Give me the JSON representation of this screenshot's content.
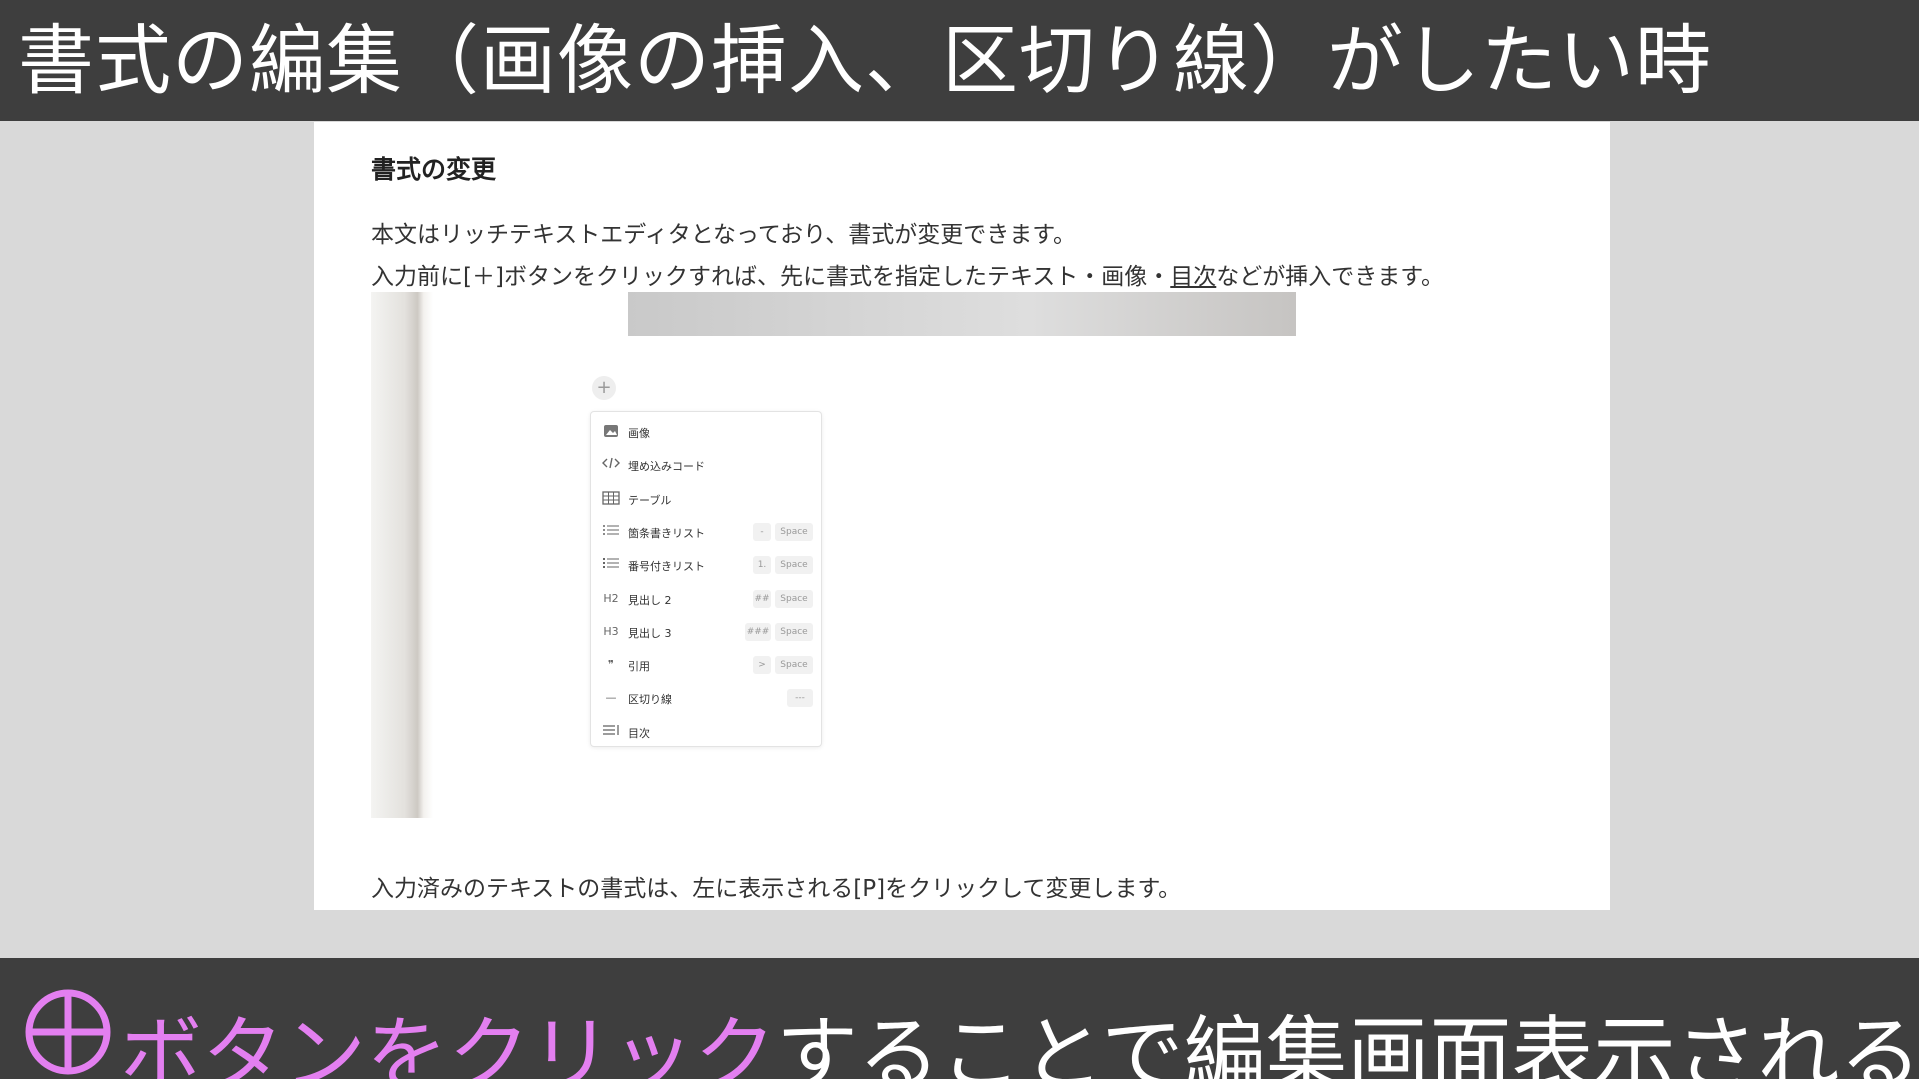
{
  "header": {
    "title": "書式の編集（画像の挿入、区切り線）がしたい時"
  },
  "document": {
    "heading": "書式の変更",
    "para1": "本文はリッチテキストエディタとなっており、書式が変更できます。",
    "para2_pre": "入力前に[＋]ボタンをクリックすれば、先に書式を指定したテキスト・画像・",
    "para2_link": "目次",
    "para2_post": "などが挿入できます。",
    "para3": "入力済みのテキストの書式は、左に表示される[P]をクリックして変更します。"
  },
  "plus_button": {
    "label": "+"
  },
  "menu": {
    "items": [
      {
        "icon": "image-icon",
        "label": "画像",
        "keys": []
      },
      {
        "icon": "code-icon",
        "label": "埋め込みコード",
        "keys": []
      },
      {
        "icon": "table-icon",
        "label": "テーブル",
        "keys": []
      },
      {
        "icon": "bullet-list-icon",
        "label": "箇条書きリスト",
        "keys": [
          "-",
          "Space"
        ]
      },
      {
        "icon": "numbered-list-icon",
        "label": "番号付きリスト",
        "keys": [
          "1.",
          "Space"
        ]
      },
      {
        "icon": "h2-icon",
        "icon_text": "H2",
        "label": "見出し 2",
        "keys": [
          "##",
          "Space"
        ]
      },
      {
        "icon": "h3-icon",
        "icon_text": "H3",
        "label": "見出し 3",
        "keys": [
          "###",
          "Space"
        ]
      },
      {
        "icon": "quote-icon",
        "icon_text": "❞",
        "label": "引用",
        "keys": [
          ">",
          "Space"
        ]
      },
      {
        "icon": "divider-icon",
        "icon_text": "—",
        "label": "区切り線",
        "keys": [
          "---"
        ]
      },
      {
        "icon": "toc-icon",
        "label": "目次",
        "keys": []
      }
    ]
  },
  "footer": {
    "highlight": "ボタンをクリック",
    "rest": "することで編集画面表示される"
  },
  "colors": {
    "banner_bg": "#3e3e3e",
    "highlight": "#e37ff0"
  }
}
